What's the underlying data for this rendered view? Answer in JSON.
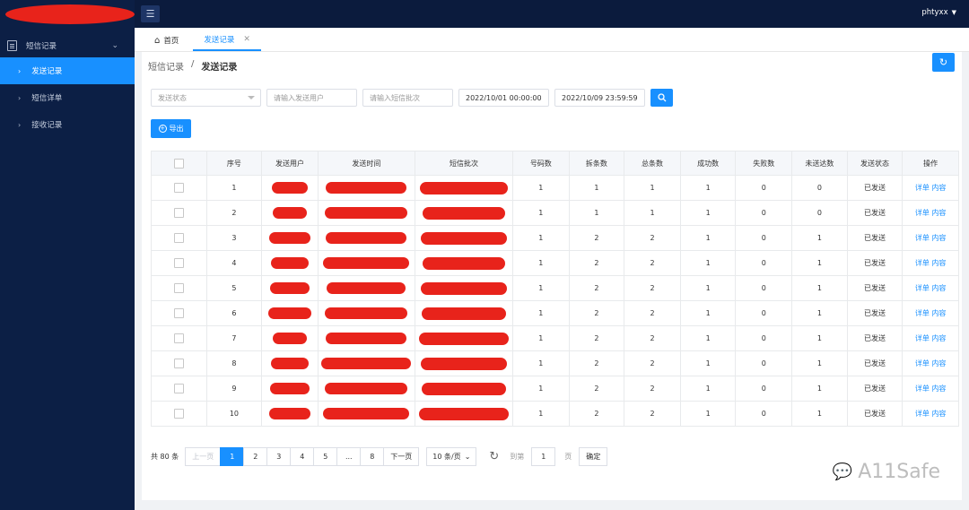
{
  "header": {
    "user": "phtyxx"
  },
  "sidebar": {
    "group_label": "短信记录",
    "items": [
      {
        "label": "发送记录",
        "active": true
      },
      {
        "label": "短信详单",
        "active": false
      },
      {
        "label": "接收记录",
        "active": false
      }
    ]
  },
  "tabs": [
    {
      "label": "首页"
    },
    {
      "label": "发送记录"
    }
  ],
  "breadcrumb": {
    "parent": "短信记录",
    "separator": "/",
    "current": "发送记录"
  },
  "filters": {
    "status_placeholder": "发送状态",
    "user_placeholder": "请输入发送用户",
    "batch_placeholder": "请输入短信批次",
    "start_time": "2022/10/01 00:00:00",
    "end_time": "2022/10/09 23:59:59"
  },
  "export_label": "导出",
  "table": {
    "headers": [
      "序号",
      "发送用户",
      "发送时间",
      "短信批次",
      "号码数",
      "拆条数",
      "总条数",
      "成功数",
      "失败数",
      "未送达数",
      "发送状态",
      "操作"
    ],
    "rows": [
      {
        "no": "1",
        "numbers": "1",
        "splits": "1",
        "total": "1",
        "success": "1",
        "fail": "0",
        "undelivered": "0",
        "status": "已发送"
      },
      {
        "no": "2",
        "numbers": "1",
        "splits": "1",
        "total": "1",
        "success": "1",
        "fail": "0",
        "undelivered": "0",
        "status": "已发送"
      },
      {
        "no": "3",
        "numbers": "1",
        "splits": "2",
        "total": "2",
        "success": "1",
        "fail": "0",
        "undelivered": "1",
        "status": "已发送"
      },
      {
        "no": "4",
        "numbers": "1",
        "splits": "2",
        "total": "2",
        "success": "1",
        "fail": "0",
        "undelivered": "1",
        "status": "已发送"
      },
      {
        "no": "5",
        "numbers": "1",
        "splits": "2",
        "total": "2",
        "success": "1",
        "fail": "0",
        "undelivered": "1",
        "status": "已发送"
      },
      {
        "no": "6",
        "numbers": "1",
        "splits": "2",
        "total": "2",
        "success": "1",
        "fail": "0",
        "undelivered": "1",
        "status": "已发送"
      },
      {
        "no": "7",
        "numbers": "1",
        "splits": "2",
        "total": "2",
        "success": "1",
        "fail": "0",
        "undelivered": "1",
        "status": "已发送"
      },
      {
        "no": "8",
        "numbers": "1",
        "splits": "2",
        "total": "2",
        "success": "1",
        "fail": "0",
        "undelivered": "1",
        "status": "已发送"
      },
      {
        "no": "9",
        "numbers": "1",
        "splits": "2",
        "total": "2",
        "success": "1",
        "fail": "0",
        "undelivered": "1",
        "status": "已发送"
      },
      {
        "no": "10",
        "numbers": "1",
        "splits": "2",
        "total": "2",
        "success": "1",
        "fail": "0",
        "undelivered": "1",
        "status": "已发送"
      }
    ],
    "action_detail": "详单",
    "action_content": "内容"
  },
  "pagination": {
    "total": "共 80 条",
    "prev": "上一页",
    "pages": [
      "1",
      "2",
      "3",
      "4",
      "5",
      "...",
      "8"
    ],
    "current": "1",
    "next": "下一页",
    "page_size": "10 条/页",
    "goto_label": "到第",
    "goto_value": "1",
    "page_suffix": "页",
    "confirm": "确定"
  },
  "watermark": "A11Safe",
  "colors": {
    "primary": "#1890ff",
    "sidebar_bg": "#0c1f45",
    "redaction": "#e8231b"
  }
}
